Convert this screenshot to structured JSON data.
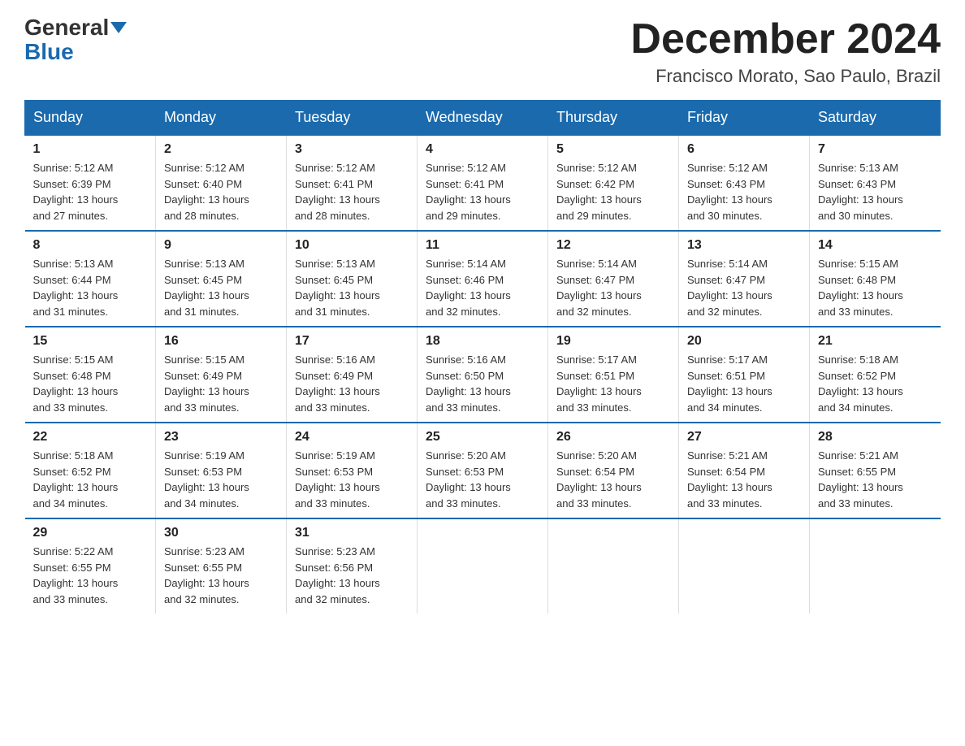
{
  "logo": {
    "general": "General",
    "blue": "Blue"
  },
  "title": {
    "month": "December 2024",
    "location": "Francisco Morato, Sao Paulo, Brazil"
  },
  "header_days": [
    "Sunday",
    "Monday",
    "Tuesday",
    "Wednesday",
    "Thursday",
    "Friday",
    "Saturday"
  ],
  "weeks": [
    [
      {
        "day": "1",
        "info": "Sunrise: 5:12 AM\nSunset: 6:39 PM\nDaylight: 13 hours\nand 27 minutes."
      },
      {
        "day": "2",
        "info": "Sunrise: 5:12 AM\nSunset: 6:40 PM\nDaylight: 13 hours\nand 28 minutes."
      },
      {
        "day": "3",
        "info": "Sunrise: 5:12 AM\nSunset: 6:41 PM\nDaylight: 13 hours\nand 28 minutes."
      },
      {
        "day": "4",
        "info": "Sunrise: 5:12 AM\nSunset: 6:41 PM\nDaylight: 13 hours\nand 29 minutes."
      },
      {
        "day": "5",
        "info": "Sunrise: 5:12 AM\nSunset: 6:42 PM\nDaylight: 13 hours\nand 29 minutes."
      },
      {
        "day": "6",
        "info": "Sunrise: 5:12 AM\nSunset: 6:43 PM\nDaylight: 13 hours\nand 30 minutes."
      },
      {
        "day": "7",
        "info": "Sunrise: 5:13 AM\nSunset: 6:43 PM\nDaylight: 13 hours\nand 30 minutes."
      }
    ],
    [
      {
        "day": "8",
        "info": "Sunrise: 5:13 AM\nSunset: 6:44 PM\nDaylight: 13 hours\nand 31 minutes."
      },
      {
        "day": "9",
        "info": "Sunrise: 5:13 AM\nSunset: 6:45 PM\nDaylight: 13 hours\nand 31 minutes."
      },
      {
        "day": "10",
        "info": "Sunrise: 5:13 AM\nSunset: 6:45 PM\nDaylight: 13 hours\nand 31 minutes."
      },
      {
        "day": "11",
        "info": "Sunrise: 5:14 AM\nSunset: 6:46 PM\nDaylight: 13 hours\nand 32 minutes."
      },
      {
        "day": "12",
        "info": "Sunrise: 5:14 AM\nSunset: 6:47 PM\nDaylight: 13 hours\nand 32 minutes."
      },
      {
        "day": "13",
        "info": "Sunrise: 5:14 AM\nSunset: 6:47 PM\nDaylight: 13 hours\nand 32 minutes."
      },
      {
        "day": "14",
        "info": "Sunrise: 5:15 AM\nSunset: 6:48 PM\nDaylight: 13 hours\nand 33 minutes."
      }
    ],
    [
      {
        "day": "15",
        "info": "Sunrise: 5:15 AM\nSunset: 6:48 PM\nDaylight: 13 hours\nand 33 minutes."
      },
      {
        "day": "16",
        "info": "Sunrise: 5:15 AM\nSunset: 6:49 PM\nDaylight: 13 hours\nand 33 minutes."
      },
      {
        "day": "17",
        "info": "Sunrise: 5:16 AM\nSunset: 6:49 PM\nDaylight: 13 hours\nand 33 minutes."
      },
      {
        "day": "18",
        "info": "Sunrise: 5:16 AM\nSunset: 6:50 PM\nDaylight: 13 hours\nand 33 minutes."
      },
      {
        "day": "19",
        "info": "Sunrise: 5:17 AM\nSunset: 6:51 PM\nDaylight: 13 hours\nand 33 minutes."
      },
      {
        "day": "20",
        "info": "Sunrise: 5:17 AM\nSunset: 6:51 PM\nDaylight: 13 hours\nand 34 minutes."
      },
      {
        "day": "21",
        "info": "Sunrise: 5:18 AM\nSunset: 6:52 PM\nDaylight: 13 hours\nand 34 minutes."
      }
    ],
    [
      {
        "day": "22",
        "info": "Sunrise: 5:18 AM\nSunset: 6:52 PM\nDaylight: 13 hours\nand 34 minutes."
      },
      {
        "day": "23",
        "info": "Sunrise: 5:19 AM\nSunset: 6:53 PM\nDaylight: 13 hours\nand 34 minutes."
      },
      {
        "day": "24",
        "info": "Sunrise: 5:19 AM\nSunset: 6:53 PM\nDaylight: 13 hours\nand 33 minutes."
      },
      {
        "day": "25",
        "info": "Sunrise: 5:20 AM\nSunset: 6:53 PM\nDaylight: 13 hours\nand 33 minutes."
      },
      {
        "day": "26",
        "info": "Sunrise: 5:20 AM\nSunset: 6:54 PM\nDaylight: 13 hours\nand 33 minutes."
      },
      {
        "day": "27",
        "info": "Sunrise: 5:21 AM\nSunset: 6:54 PM\nDaylight: 13 hours\nand 33 minutes."
      },
      {
        "day": "28",
        "info": "Sunrise: 5:21 AM\nSunset: 6:55 PM\nDaylight: 13 hours\nand 33 minutes."
      }
    ],
    [
      {
        "day": "29",
        "info": "Sunrise: 5:22 AM\nSunset: 6:55 PM\nDaylight: 13 hours\nand 33 minutes."
      },
      {
        "day": "30",
        "info": "Sunrise: 5:23 AM\nSunset: 6:55 PM\nDaylight: 13 hours\nand 32 minutes."
      },
      {
        "day": "31",
        "info": "Sunrise: 5:23 AM\nSunset: 6:56 PM\nDaylight: 13 hours\nand 32 minutes."
      },
      {
        "day": "",
        "info": ""
      },
      {
        "day": "",
        "info": ""
      },
      {
        "day": "",
        "info": ""
      },
      {
        "day": "",
        "info": ""
      }
    ]
  ]
}
